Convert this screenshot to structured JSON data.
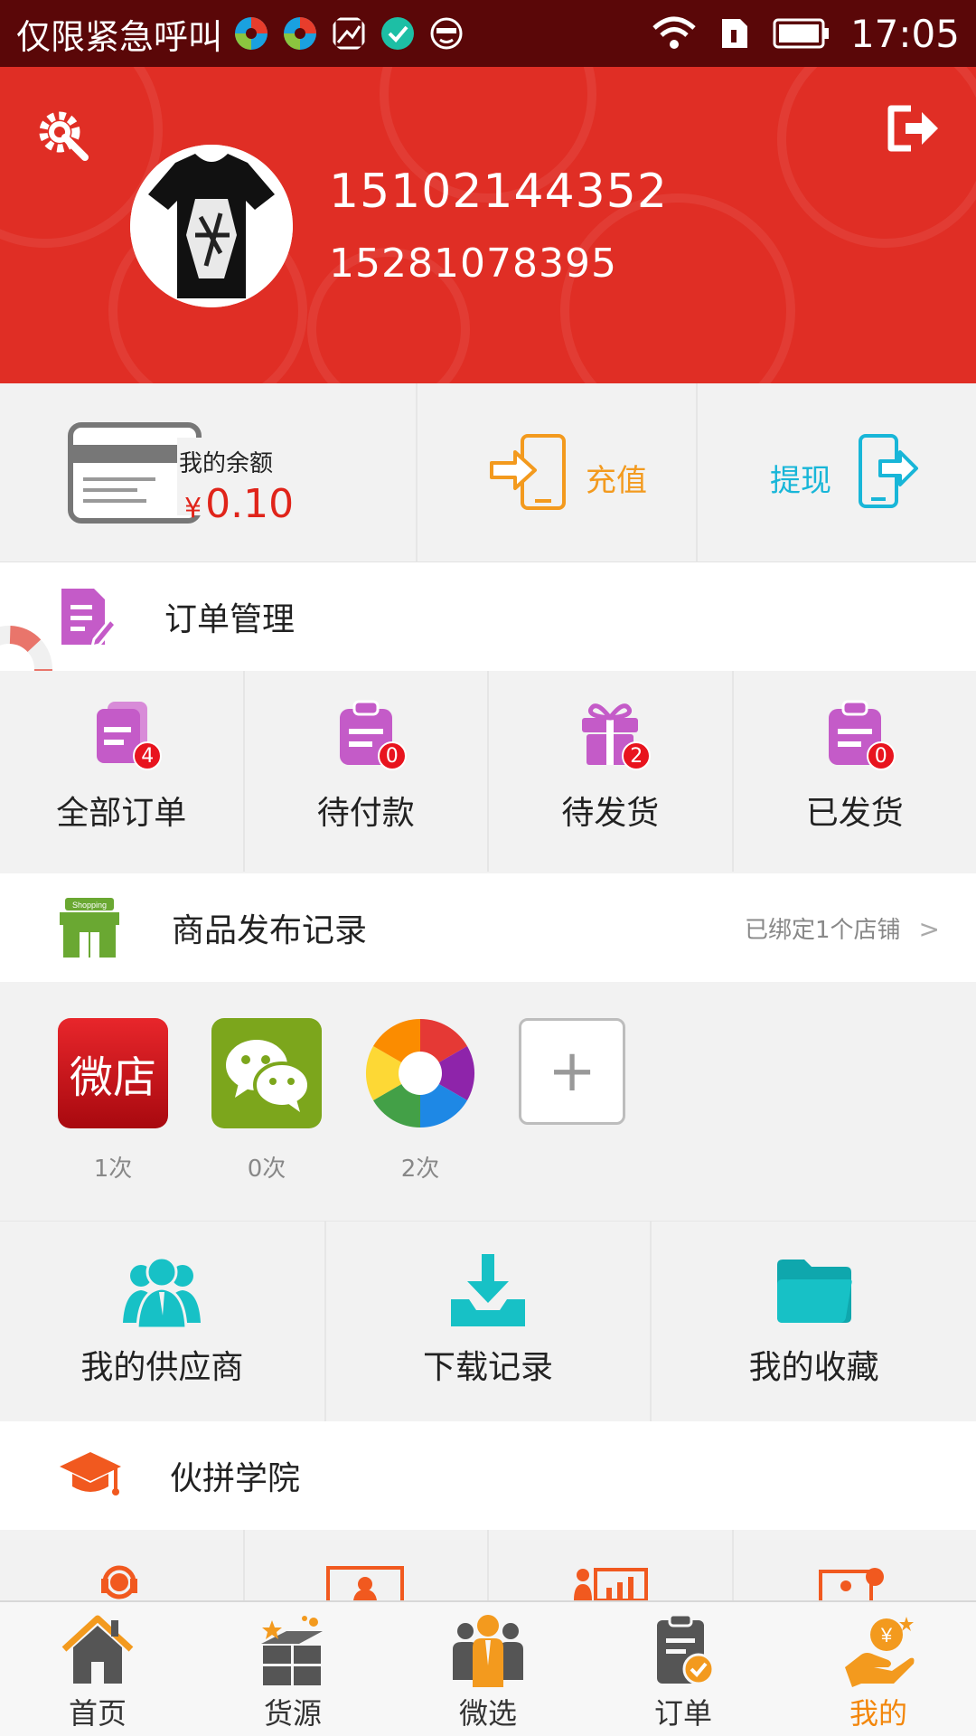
{
  "status_bar": {
    "carrier": "仅限紧急呼叫",
    "time": "17:05"
  },
  "profile": {
    "username": "15102144352",
    "phone": "15281078395"
  },
  "wallet": {
    "balance_label": "我的余额",
    "currency": "¥",
    "balance_value": "0.10",
    "recharge_label": "充值",
    "withdraw_label": "提现"
  },
  "orders": {
    "title": "订单管理",
    "items": [
      {
        "label": "全部订单",
        "count": "4"
      },
      {
        "label": "待付款",
        "count": "0"
      },
      {
        "label": "待发货",
        "count": "2"
      },
      {
        "label": "已发货",
        "count": "0"
      }
    ]
  },
  "publish": {
    "title": "商品发布记录",
    "subtitle": "已绑定1个店铺",
    "chevron": ">",
    "shop_sign": "Shopping",
    "platforms": [
      {
        "icon_text": "微店",
        "count": "1次"
      },
      {
        "icon_text": "",
        "count": "0次"
      },
      {
        "icon_text": "",
        "count": "2次"
      }
    ],
    "add_symbol": "+"
  },
  "tools": [
    {
      "label": "我的供应商"
    },
    {
      "label": "下载记录"
    },
    {
      "label": "我的收藏"
    }
  ],
  "academy": {
    "title": "伙拼学院"
  },
  "nav": [
    {
      "label": "首页",
      "active": false
    },
    {
      "label": "货源",
      "active": false
    },
    {
      "label": "微选",
      "active": false
    },
    {
      "label": "订单",
      "active": false
    },
    {
      "label": "我的",
      "active": true
    }
  ],
  "colors": {
    "header_red": "#e02e25",
    "accent_orange": "#f39a1e",
    "accent_cyan": "#18b6d8",
    "order_icon_purple": "#c45bc8",
    "badge_red": "#e8141e",
    "nav_active": "#f3870c"
  }
}
